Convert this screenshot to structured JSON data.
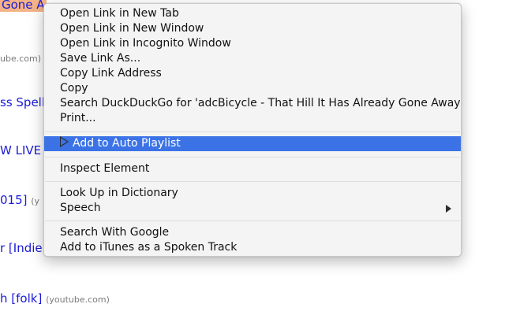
{
  "background": {
    "items": [
      {
        "text": "Gone A",
        "source": ""
      },
      {
        "text": "",
        "source": "ube.com)"
      },
      {
        "text": "ss Spell",
        "source": ""
      },
      {
        "text": "W LIVE",
        "source": ""
      },
      {
        "text": "015]",
        "source": "(y"
      },
      {
        "text": "r [Indie",
        "source": ""
      },
      {
        "text": "h [folk]",
        "source": "(youtube.com)"
      }
    ],
    "highlight_color": "#f4b488",
    "link_color": "#1a1ad6"
  },
  "context_menu": {
    "groups": [
      [
        "Open Link in New Tab",
        "Open Link in New Window",
        "Open Link in Incognito Window",
        "Save Link As...",
        "Copy Link Address",
        "Copy",
        "Search DuckDuckGo for 'adcBicycle - That Hill It Has Already Gone Away'",
        "Print..."
      ],
      [
        "Add to Auto Playlist"
      ],
      [
        "Inspect Element"
      ],
      [
        "Look Up in Dictionary",
        "Speech"
      ],
      [
        "Search With Google",
        "Add to iTunes as a Spoken Track"
      ]
    ],
    "active_item": "Add to Auto Playlist",
    "active_icon": "play-triangle-icon",
    "submenu_icon": "submenu-arrow-icon",
    "highlight_color": "#3b73e6"
  }
}
